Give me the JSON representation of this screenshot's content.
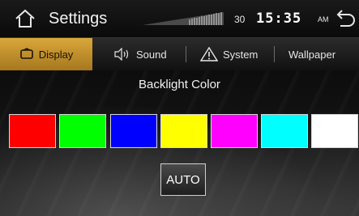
{
  "header": {
    "title": "Settings",
    "day": "30",
    "time": "15:35",
    "ampm": "AM"
  },
  "tabs": [
    {
      "label": "Display",
      "icon": "display-icon",
      "active": true
    },
    {
      "label": "Sound",
      "icon": "speaker-icon",
      "active": false
    },
    {
      "label": "System",
      "icon": "warning-icon",
      "active": false
    },
    {
      "label": "Wallpaper",
      "icon": "",
      "active": false
    }
  ],
  "backlight": {
    "title": "Backlight Color",
    "colors": [
      "#ff0000",
      "#00ff00",
      "#0000ff",
      "#ffff00",
      "#ff00ff",
      "#00ffff",
      "#ffffff"
    ],
    "auto_label": "AUTO"
  },
  "accent": "#c8962b"
}
